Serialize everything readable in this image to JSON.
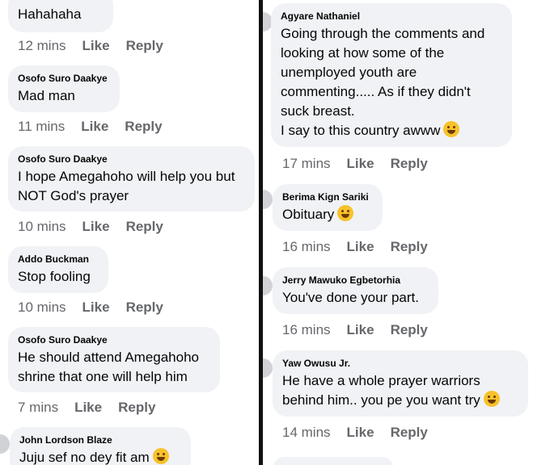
{
  "left": [
    {
      "author": "",
      "text": "Hahahaha",
      "time": "12 mins",
      "like": "Like",
      "reply": "Reply"
    },
    {
      "author": "Osofo Suro Daakye",
      "text": "Mad man",
      "time": "11 mins",
      "like": "Like",
      "reply": "Reply"
    },
    {
      "author": "Osofo Suro Daakye",
      "text": "I hope Amegahoho will help you but\nNOT God's prayer",
      "time": "10 mins",
      "like": "Like",
      "reply": "Reply"
    },
    {
      "author": "Addo Buckman",
      "text": "Stop fooling",
      "time": "10 mins",
      "like": "Like",
      "reply": "Reply"
    },
    {
      "author": "Osofo Suro Daakye",
      "text": "He should attend Amegahoho\nshrine that one will help him",
      "time": "7 mins",
      "like": "Like",
      "reply": "Reply"
    },
    {
      "author": "John Lordson Blaze",
      "text": "Juju sef no dey fit am",
      "time": "",
      "like": "",
      "reply": ""
    }
  ],
  "right": [
    {
      "author": "Agyare Nathaniel",
      "text": "Going through the comments and\nlooking at how some of the\nunemployed youth are\ncommenting..... As if they didn't\nsuck breast.\nI say to this country awww",
      "time": "17 mins",
      "like": "Like",
      "reply": "Reply"
    },
    {
      "author": "Berima Kign Sariki",
      "text": "Obituary",
      "time": "16 mins",
      "like": "Like",
      "reply": "Reply"
    },
    {
      "author": "Jerry Mawuko Egbetorhia",
      "text": "You've done your part.",
      "time": "16 mins",
      "like": "Like",
      "reply": "Reply"
    },
    {
      "author": "Yaw Owusu Jr.",
      "text": "He have a whole prayer warriors\nbehind him.. you pe you want try",
      "time": "14 mins",
      "like": "Like",
      "reply": "Reply"
    }
  ]
}
